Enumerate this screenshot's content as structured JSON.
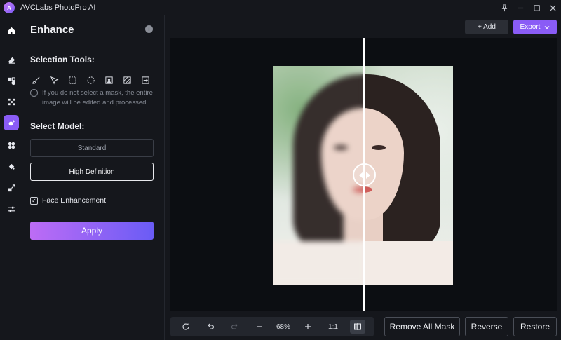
{
  "app": {
    "title": "AVCLabs PhotoPro AI",
    "logo_text": "A"
  },
  "panel": {
    "title": "Enhance",
    "info_icon": "i",
    "selection_tools_label": "Selection Tools:",
    "hint_icon": "i",
    "hint": "If you do not select a mask, the entire image will be edited and processed...",
    "select_model_label": "Select Model:",
    "models": [
      "Standard",
      "High Definition"
    ],
    "selected_model": "High Definition",
    "face_enhancement_label": "Face Enhancement",
    "face_enhancement_checked": true,
    "apply_label": "Apply"
  },
  "header": {
    "add_label": "+ Add",
    "export_label": "Export"
  },
  "toolbar": {
    "zoom": "68%",
    "ratio_label": "1:1"
  },
  "actions": {
    "remove_all_mask": "Remove All Mask",
    "reverse": "Reverse",
    "restore": "Restore"
  },
  "colors": {
    "accent": "#8a5cf6",
    "background": "#15171c",
    "canvas": "#0c0e12"
  }
}
